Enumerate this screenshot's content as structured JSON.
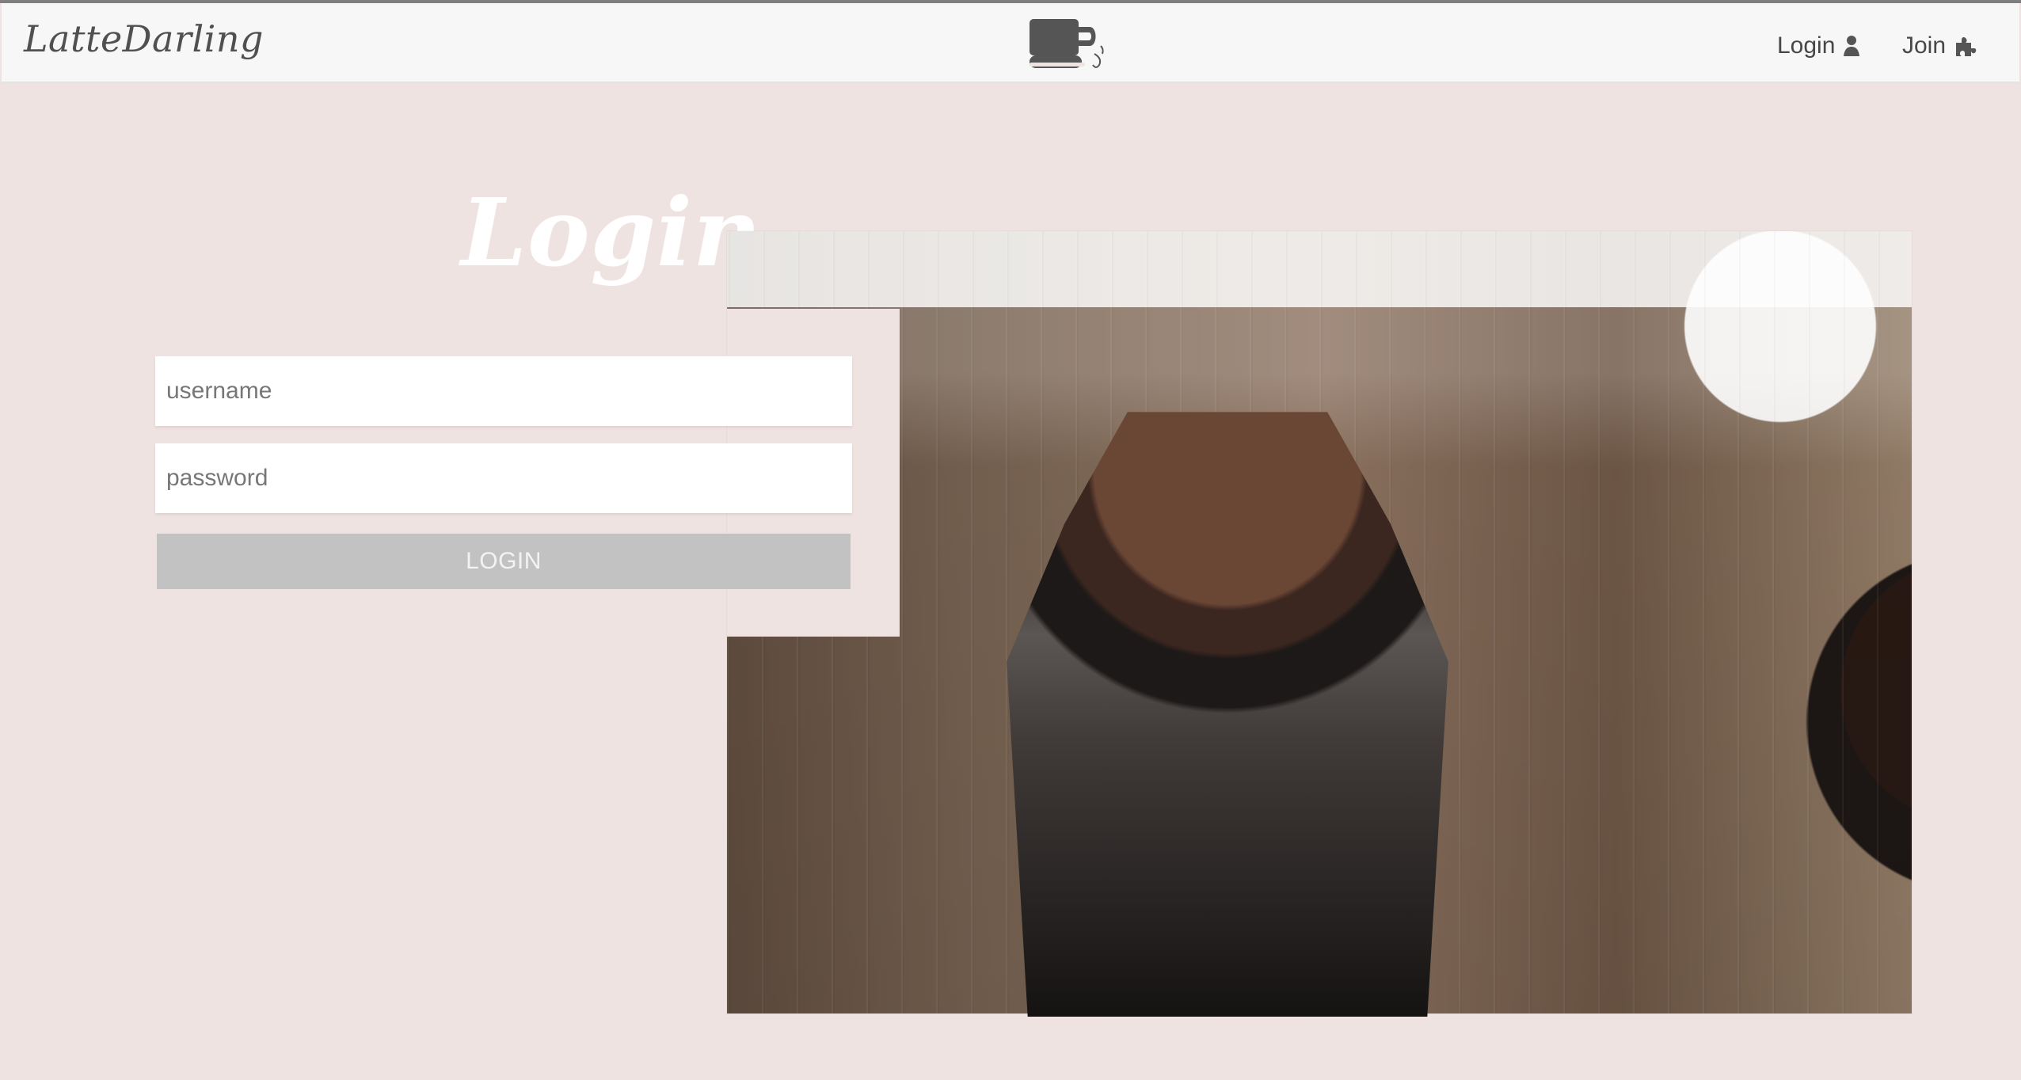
{
  "nav": {
    "brand": "LatteDarling",
    "logo_icon": "coffee-cup-icon",
    "login_label": "Login",
    "login_icon": "user-icon",
    "join_label": "Join",
    "join_icon": "puzzle-icon"
  },
  "page": {
    "title": "Login"
  },
  "form": {
    "username_placeholder": "username",
    "password_placeholder": "password",
    "button_label": "LOGIN"
  },
  "colors": {
    "page_background": "#efe3e1",
    "nav_background": "#f7f7f7",
    "title": "#ffffff",
    "button": "#c2c2c2"
  },
  "image": {
    "subject": "coffee-pot-with-grounds"
  }
}
